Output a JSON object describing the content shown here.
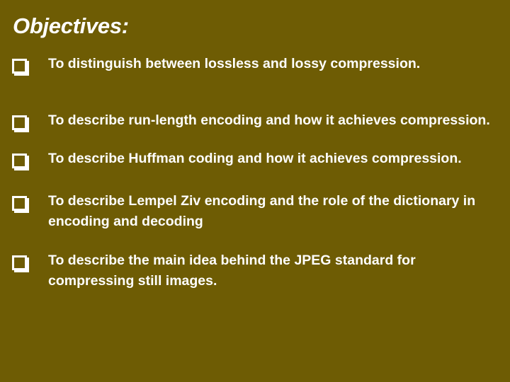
{
  "slide": {
    "background_color": "#6e5c04",
    "text_color": "#ffffff",
    "title": "Objectives:",
    "bullet_glyph": "hollow-square",
    "bullets": [
      {
        "text": "To distinguish between lossless and lossy compression."
      },
      {
        "text": "To describe run-length encoding and how it achieves compression."
      },
      {
        "text": "To describe Huffman coding and how it achieves compression."
      },
      {
        "text": "To describe Lempel Ziv encoding and the role of the dictionary in encoding and decoding"
      },
      {
        "text": "To describe the main idea behind the JPEG standard for compressing still images."
      }
    ]
  }
}
